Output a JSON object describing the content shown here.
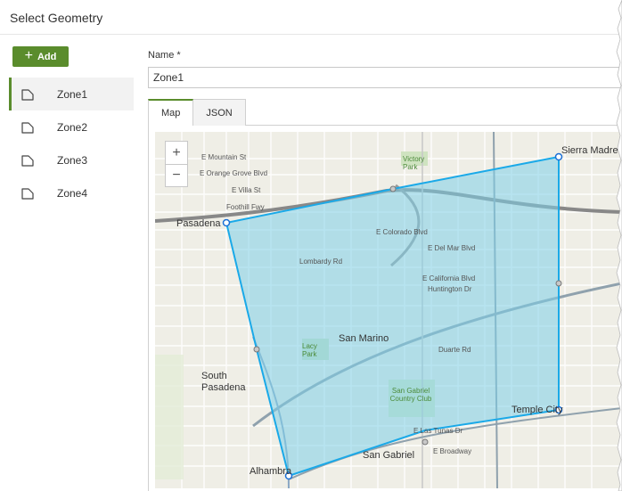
{
  "header": {
    "title": "Select Geometry"
  },
  "toolbar": {
    "add_label": "Add"
  },
  "zones": [
    {
      "label": "Zone1",
      "active": true
    },
    {
      "label": "Zone2"
    },
    {
      "label": "Zone3"
    },
    {
      "label": "Zone4"
    }
  ],
  "form": {
    "name_label": "Name *",
    "name_value": "Zone1"
  },
  "tabs": [
    {
      "label": "Map",
      "active": true
    },
    {
      "label": "JSON"
    }
  ],
  "map": {
    "zoom_in": "+",
    "zoom_out": "−",
    "labels": {
      "sierra_madre": "Sierra Madre",
      "pasadena": "Pasadena",
      "san_marino": "San Marino",
      "south_pasadena": "South Pasadena",
      "temple_city": "Temple City",
      "san_gabriel": "San Gabriel",
      "alhambra": "Alhambra",
      "victory_park": "Victory Park",
      "lacy_park": "Lacy Park",
      "country_club": "San Gabriel Country Club",
      "foothill_fwy": "Foothill Fwy",
      "huntington_dr": "Huntington Dr",
      "colorado_blvd": "E Colorado Blvd",
      "del_mar": "E Del Mar Blvd",
      "california_blvd": "E California Blvd",
      "lombardy": "Lombardy Rd",
      "duarte": "Duarte Rd",
      "las_tunas": "E Las Tunas Dr",
      "broadway": "E Broadway",
      "mountain": "E Mountain St",
      "villa": "E Villa St",
      "orange_grove": "E Orange Grove Blvd"
    }
  },
  "colors": {
    "accent": "#5a8c2c",
    "polygon_stroke": "#1aa9e8",
    "polygon_fill": "#7ecfe8"
  }
}
